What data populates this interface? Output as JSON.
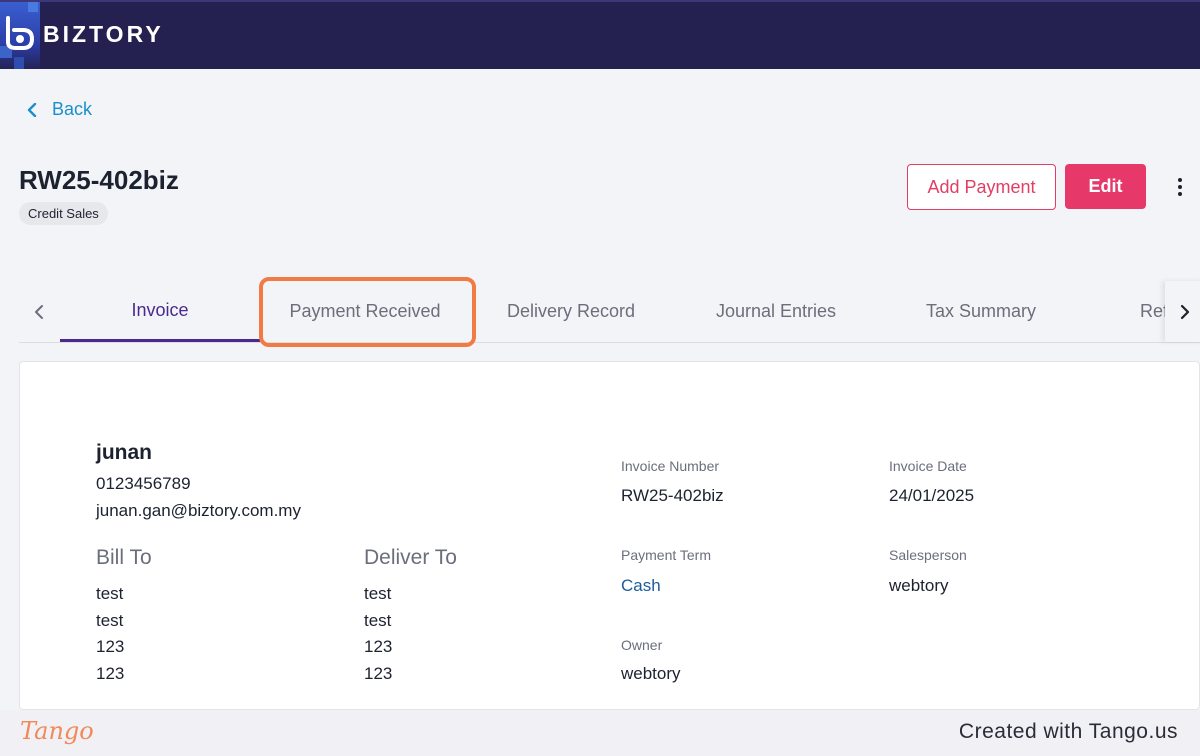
{
  "app": {
    "brand": "BIZTORY"
  },
  "nav": {
    "back_label": "Back"
  },
  "document": {
    "title": "RW25-402biz",
    "badge": "Credit Sales"
  },
  "actions": {
    "add_payment": "Add Payment",
    "edit": "Edit"
  },
  "tabs": [
    {
      "label": "Invoice",
      "active": true
    },
    {
      "label": "Payment Received",
      "active": false
    },
    {
      "label": "Delivery Record",
      "active": false
    },
    {
      "label": "Journal Entries",
      "active": false
    },
    {
      "label": "Tax Summary",
      "active": false
    },
    {
      "label": "References",
      "active": false
    }
  ],
  "invoice": {
    "customer": {
      "name": "junan",
      "phone": "0123456789",
      "email": "junan.gan@biztory.com.my"
    },
    "bill_to": {
      "heading": "Bill To",
      "lines": [
        "test",
        "test",
        "123",
        "123"
      ]
    },
    "deliver_to": {
      "heading": "Deliver To",
      "lines": [
        "test",
        "test",
        "123",
        "123"
      ]
    },
    "fields": {
      "invoice_number": {
        "label": "Invoice Number",
        "value": "RW25-402biz"
      },
      "invoice_date": {
        "label": "Invoice Date",
        "value": "24/01/2025"
      },
      "payment_term": {
        "label": "Payment Term",
        "value": "Cash"
      },
      "salesperson": {
        "label": "Salesperson",
        "value": "webtory"
      },
      "owner": {
        "label": "Owner",
        "value": "webtory"
      }
    }
  },
  "footer": {
    "logo": "Tango",
    "created": "Created with Tango.us"
  },
  "colors": {
    "topbar": "#24204f",
    "accent": "#e6396a",
    "tab_active": "#4a2a8c",
    "highlight": "#f27b45",
    "link": "#1b8fcc"
  },
  "icons": {
    "back": "chevron-left-icon",
    "more": "kebab-menu-icon",
    "tab_prev": "chevron-left-icon",
    "tab_next": "chevron-right-icon"
  }
}
